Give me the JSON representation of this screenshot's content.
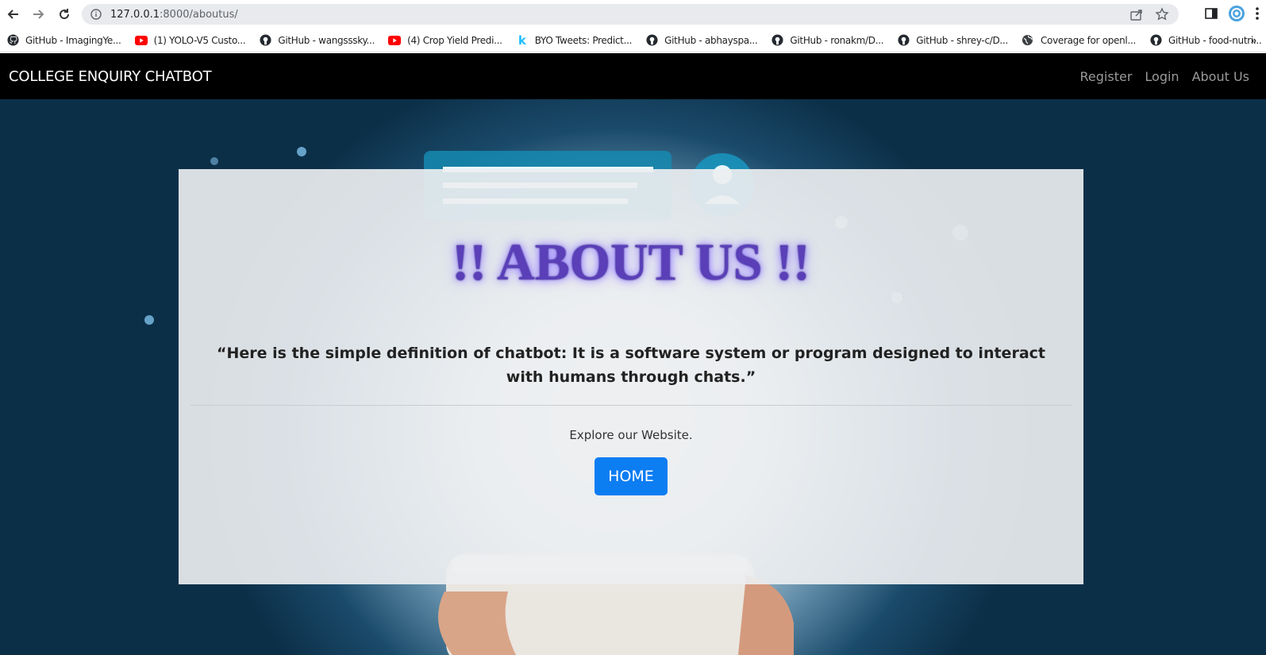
{
  "browser": {
    "url_host": "127.0.0.1",
    "url_rest": ":8000/aboutus/",
    "bookmarks": [
      {
        "label": "GitHub - ImagingYe...",
        "icon": "github-icon"
      },
      {
        "label": "(1) YOLO-V5 Custo...",
        "icon": "youtube-icon"
      },
      {
        "label": "GitHub - wangsssky...",
        "icon": "github-icon"
      },
      {
        "label": "(4) Crop Yield Predi...",
        "icon": "youtube-icon"
      },
      {
        "label": "BYO Tweets: Predict...",
        "icon": "kaggle-icon"
      },
      {
        "label": "GitHub - abhayspa...",
        "icon": "github-icon"
      },
      {
        "label": "GitHub - ronakm/D...",
        "icon": "github-icon"
      },
      {
        "label": "GitHub - shrey-c/D...",
        "icon": "github-icon"
      },
      {
        "label": "Coverage for openl...",
        "icon": "globe-icon"
      },
      {
        "label": "GitHub - food-nutri...",
        "icon": "github-icon"
      }
    ],
    "more": "»"
  },
  "navbar": {
    "brand": "COLLEGE ENQUIRY CHATBOT",
    "links": [
      "Register",
      "Login",
      "About Us"
    ]
  },
  "main": {
    "title": "!! ABOUT US !!",
    "quote": "“Here is the simple definition of chatbot: It is a software system or program designed to interact with humans through chats.”",
    "explore": "Explore our Website.",
    "home_button": "HOME"
  },
  "colors": {
    "navbar_bg": "#000000",
    "home_button_bg": "#0d7df2",
    "title_color": "#5a3fb8"
  }
}
